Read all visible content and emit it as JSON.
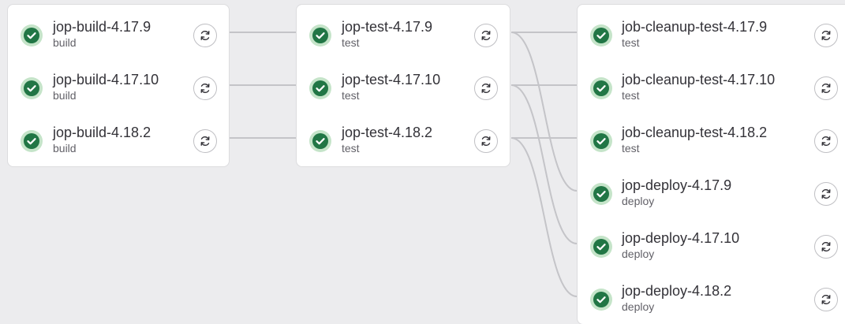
{
  "colors": {
    "success": "#217645",
    "success_ring": "#c5e4c9",
    "link_line": "#c4c4c8",
    "background": "#ececee"
  },
  "icons": {
    "status": "status-success-check-icon",
    "retry": "retry-icon"
  },
  "stages": [
    {
      "key": "build",
      "jobs": [
        {
          "name": "jop-build-4.17.9",
          "stage": "build"
        },
        {
          "name": "jop-build-4.17.10",
          "stage": "build"
        },
        {
          "name": "jop-build-4.18.2",
          "stage": "build"
        }
      ]
    },
    {
      "key": "test",
      "jobs": [
        {
          "name": "jop-test-4.17.9",
          "stage": "test"
        },
        {
          "name": "jop-test-4.17.10",
          "stage": "test"
        },
        {
          "name": "jop-test-4.18.2",
          "stage": "test"
        }
      ]
    },
    {
      "key": "cleanup",
      "jobs": [
        {
          "name": "job-cleanup-test-4.17.9",
          "stage": "test"
        },
        {
          "name": "job-cleanup-test-4.17.10",
          "stage": "test"
        },
        {
          "name": "job-cleanup-test-4.18.2",
          "stage": "test"
        },
        {
          "name": "jop-deploy-4.17.9",
          "stage": "deploy"
        },
        {
          "name": "jop-deploy-4.17.10",
          "stage": "deploy"
        },
        {
          "name": "jop-deploy-4.18.2",
          "stage": "deploy"
        }
      ]
    }
  ]
}
